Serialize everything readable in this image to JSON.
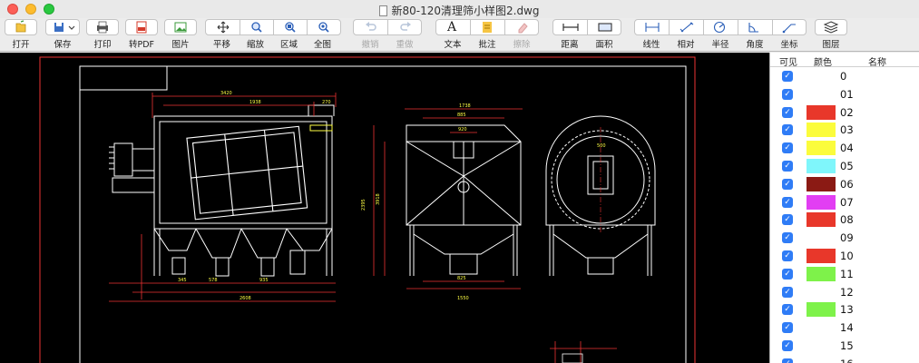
{
  "window": {
    "title": "新80-120清理筛小样图2.dwg"
  },
  "toolbar": {
    "open": "打开",
    "save": "保存",
    "print": "打印",
    "to_pdf": "转PDF",
    "image": "图片",
    "pan": "平移",
    "zoom": "缩放",
    "region": "区域",
    "full": "全图",
    "undo": "撤销",
    "redo": "重做",
    "text": "文本",
    "annotate": "批注",
    "erase": "擦除",
    "distance": "距离",
    "area": "面积",
    "linear": "线性",
    "aligned": "相对",
    "radius": "半径",
    "angle": "角度",
    "coord": "坐标",
    "layers": "图层",
    "text_glyph": "A"
  },
  "panel": {
    "col_visible": "可见",
    "col_color": "颜色",
    "col_name": "名称",
    "check_glyph": "✓",
    "rows": [
      {
        "name": "0",
        "color": ""
      },
      {
        "name": "01",
        "color": ""
      },
      {
        "name": "02",
        "color": "#e8372a"
      },
      {
        "name": "03",
        "color": "#fbfc3c"
      },
      {
        "name": "04",
        "color": "#fbfc3c"
      },
      {
        "name": "05",
        "color": "#7ff6fb"
      },
      {
        "name": "06",
        "color": "#8b1a14"
      },
      {
        "name": "07",
        "color": "#e23ef3"
      },
      {
        "name": "08",
        "color": "#e8372a"
      },
      {
        "name": "09",
        "color": ""
      },
      {
        "name": "10",
        "color": "#e8372a"
      },
      {
        "name": "11",
        "color": "#7ef24a"
      },
      {
        "name": "12",
        "color": ""
      },
      {
        "name": "13",
        "color": "#7ef24a"
      },
      {
        "name": "14",
        "color": ""
      },
      {
        "name": "15",
        "color": ""
      },
      {
        "name": "16",
        "color": ""
      }
    ]
  },
  "drawing": {
    "dims": {
      "d1": "3420",
      "d2": "1938",
      "d3": "270",
      "d4": "1738",
      "d5": "885",
      "d6": "920",
      "d7": "345",
      "d8": "578",
      "d9": "935",
      "d10": "2608",
      "d11": "825",
      "d12": "1550",
      "d13": "2395",
      "d14": "3918",
      "d15": "500"
    }
  }
}
